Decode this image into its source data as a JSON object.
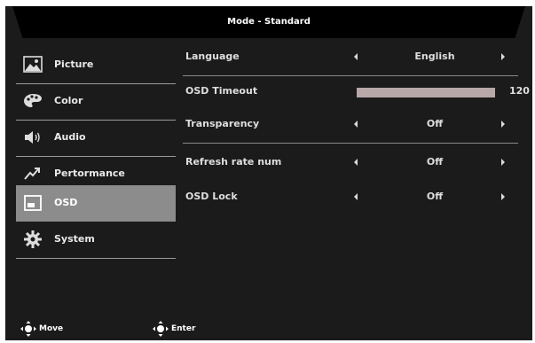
{
  "header": {
    "title": "Mode - Standard"
  },
  "sidebar": {
    "items": [
      {
        "label": "Picture",
        "icon": "picture-icon",
        "active": false
      },
      {
        "label": "Color",
        "icon": "palette-icon",
        "active": false
      },
      {
        "label": "Audio",
        "icon": "speaker-icon",
        "active": false
      },
      {
        "label": "Pertormance",
        "icon": "performance-icon",
        "active": false
      },
      {
        "label": "OSD",
        "icon": "osd-icon",
        "active": true
      },
      {
        "label": "System",
        "icon": "gear-icon",
        "active": false
      }
    ]
  },
  "settings": {
    "language": {
      "label": "Language",
      "value": "English"
    },
    "osd_timeout": {
      "label": "OSD Timeout",
      "value": "120",
      "level_percent": 100
    },
    "transparency": {
      "label": "Transparency",
      "value": "Off"
    },
    "refresh_rate_num": {
      "label": "Refresh rate num",
      "value": "Off"
    },
    "osd_lock": {
      "label": "OSD Lock",
      "value": "Off"
    }
  },
  "footer": {
    "move_label": "Move",
    "enter_label": "Enter"
  },
  "colors": {
    "background": "#1b1b1b",
    "header": "#000000",
    "active_item": "#8c8c8c",
    "text": "#e9e9e9"
  }
}
